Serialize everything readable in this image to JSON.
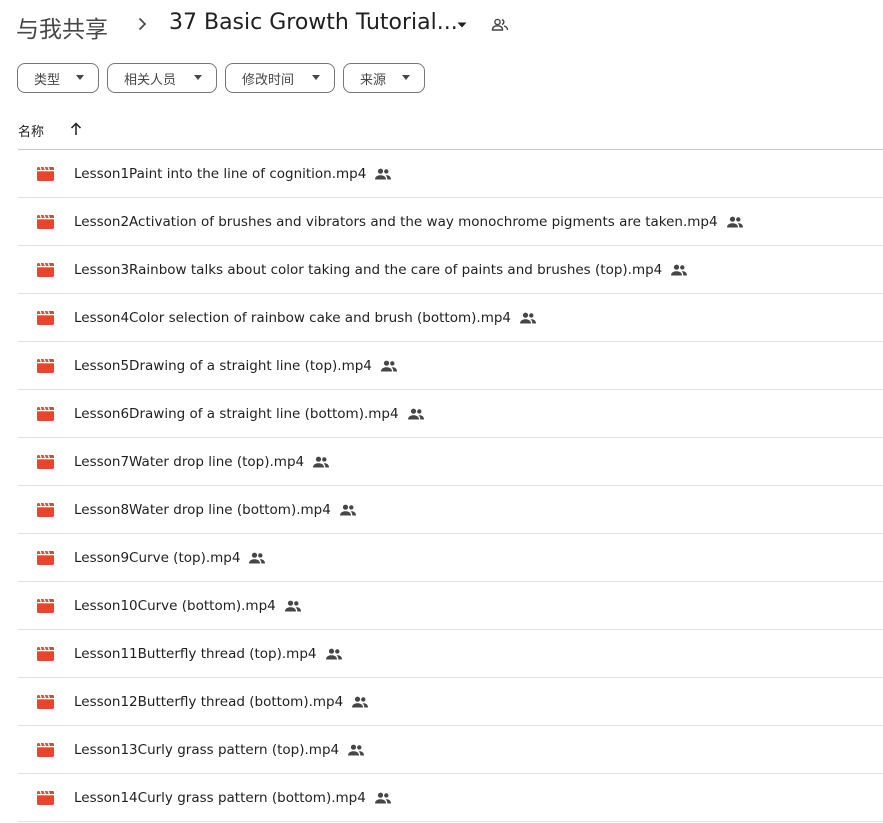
{
  "breadcrumb": {
    "root": "与我共享",
    "current": "37 Basic Growth Tutorial...",
    "separator_icon": "chevron-right-icon",
    "dropdown_icon": "caret-down-icon",
    "shared_icon": "people-outline-icon"
  },
  "filters": [
    {
      "label": "类型",
      "icon": "caret-down-icon"
    },
    {
      "label": "相关人员",
      "icon": "caret-down-icon"
    },
    {
      "label": "修改时间",
      "icon": "caret-down-icon"
    },
    {
      "label": "来源",
      "icon": "caret-down-icon"
    }
  ],
  "table": {
    "column_name": "名称",
    "sort_icon": "arrow-up-icon",
    "rows": [
      {
        "name": "Lesson1Paint into the line of cognition.mp4"
      },
      {
        "name": "Lesson2Activation of brushes and vibrators and the way monochrome pigments are taken.mp4"
      },
      {
        "name": "Lesson3Rainbow talks about color taking and the care of paints and brushes (top).mp4"
      },
      {
        "name": "Lesson4Color selection of rainbow cake and brush (bottom).mp4"
      },
      {
        "name": "Lesson5Drawing of a straight line (top).mp4"
      },
      {
        "name": "Lesson6Drawing of a straight line (bottom).mp4"
      },
      {
        "name": "Lesson7Water drop line (top).mp4"
      },
      {
        "name": "Lesson8Water drop line (bottom).mp4"
      },
      {
        "name": "Lesson9Curve (top).mp4"
      },
      {
        "name": "Lesson10Curve (bottom).mp4"
      },
      {
        "name": "Lesson11Butterfly thread (top).mp4"
      },
      {
        "name": "Lesson12Butterfly thread (bottom).mp4"
      },
      {
        "name": "Lesson13Curly grass pattern (top).mp4"
      },
      {
        "name": "Lesson14Curly grass pattern (bottom).mp4"
      }
    ]
  },
  "icons": {
    "file": "video-file-icon",
    "shared": "people-icon"
  },
  "colors": {
    "video_icon": "#ea4335",
    "text": "#1f1f1f",
    "muted": "#444746",
    "divider": "#e0e0e0"
  }
}
